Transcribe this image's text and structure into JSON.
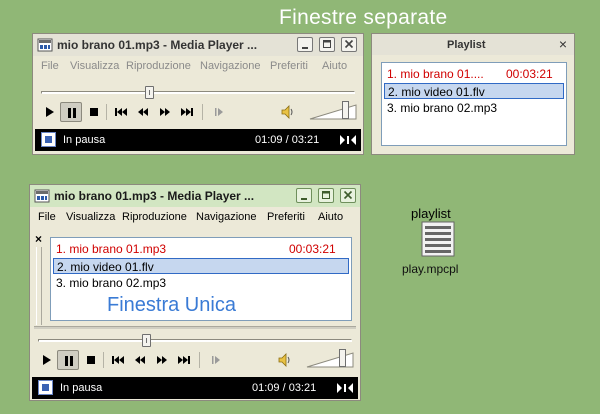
{
  "heading_separate": "Finestre separate",
  "menu": [
    "File",
    "Visualizza",
    "Riproduzione",
    "Navigazione",
    "Preferiti",
    "Aiuto"
  ],
  "player_top": {
    "title": "mio brano 01.mp3 - Media Player ...",
    "status": "In pausa",
    "time": "01:09 / 03:21",
    "seek_fraction": 0.34,
    "volume_fraction": 0.78
  },
  "playlist_window": {
    "title": "Playlist",
    "close_glyph": "×",
    "items": [
      {
        "name": "1. mio brano 01....",
        "duration": "00:03:21"
      },
      {
        "name": "2. mio video 01.flv",
        "duration": ""
      },
      {
        "name": "3. mio brano 02.mp3",
        "duration": ""
      }
    ]
  },
  "player_single": {
    "title": "mio brano 01.mp3 - Media Player ...",
    "panel_close_glyph": "×",
    "items": [
      {
        "name": "1. mio brano 01.mp3",
        "duration": "00:03:21"
      },
      {
        "name": "2. mio video 01.flv",
        "duration": ""
      },
      {
        "name": "3. mio brano 02.mp3",
        "duration": ""
      }
    ],
    "overlay_label": "Finestra Unica",
    "status": "In pausa",
    "time": "01:09 / 03:21",
    "seek_fraction": 0.34,
    "volume_fraction": 0.78
  },
  "file_icon": {
    "label": "playlist",
    "caption": "play.mpcpl"
  },
  "colors": {
    "desktop": "#90b776",
    "current_item": "#d00000",
    "selected_row": "#c6d7ef",
    "overlay_label": "#3a7bd5"
  },
  "icons": [
    "app-icon",
    "minimize-icon",
    "maximize-icon",
    "close-icon",
    "play-icon",
    "pause-icon",
    "stop-icon",
    "prev-icon",
    "rewind-icon",
    "forward-icon",
    "next-icon",
    "frame-step-icon",
    "speaker-icon",
    "status-icon",
    "widescreen-icon",
    "playlist-file-icon"
  ]
}
